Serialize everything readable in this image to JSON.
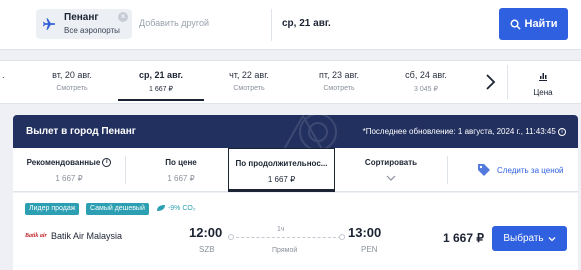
{
  "search": {
    "destination_city": "Пенанг",
    "destination_sub": "Все аэропорты",
    "add_other": "Добавить другой",
    "date": "ср, 21 авг.",
    "search_button": "Найти"
  },
  "date_strip": {
    "edge_partial": ".",
    "dates": [
      {
        "label": "вт, 20 авг.",
        "price": "Смотреть",
        "selected": false
      },
      {
        "label": "ср, 21 авг.",
        "price": "1 667 ₽",
        "selected": true
      },
      {
        "label": "чт, 22 авг.",
        "price": "Смотреть",
        "selected": false
      },
      {
        "label": "пт, 23 авг.",
        "price": "Смотреть",
        "selected": false
      },
      {
        "label": "сб, 24 авг.",
        "price": "3 045 ₽",
        "selected": false
      }
    ],
    "price_sort_label": "Цена"
  },
  "results": {
    "title": "Вылет в город Пенанг",
    "last_updated": "*Последнее обновление: 1 августа, 2024 г., 11:43:45",
    "sort_options": [
      {
        "title": "Рекомендованные",
        "value": "1 667 ₽",
        "selected": false
      },
      {
        "title": "По цене",
        "value": "1 667 ₽",
        "selected": false
      },
      {
        "title": "По продолжительнос...",
        "value": "1 667 ₽",
        "selected": true
      }
    ],
    "sort_dropdown_label": "Сортировать",
    "follow_price": "Следить за ценой"
  },
  "flight": {
    "badges": [
      "Лидер продаж",
      "Самый дешевый"
    ],
    "eco_label": "-9% CO₂",
    "airline_logo_text": "Batik air",
    "airline": "Batik Air Malaysia",
    "departure_time": "12:00",
    "departure_code": "SZB",
    "duration": "1ч",
    "stops": "Прямой",
    "arrival_time": "13:00",
    "arrival_code": "PEN",
    "price": "1 667 ₽",
    "select_button": "Выбрать"
  },
  "colors": {
    "accent": "#2f60e0",
    "banner": "#22305f",
    "badge": "#2c9fb2",
    "background": "#eef0f5"
  }
}
